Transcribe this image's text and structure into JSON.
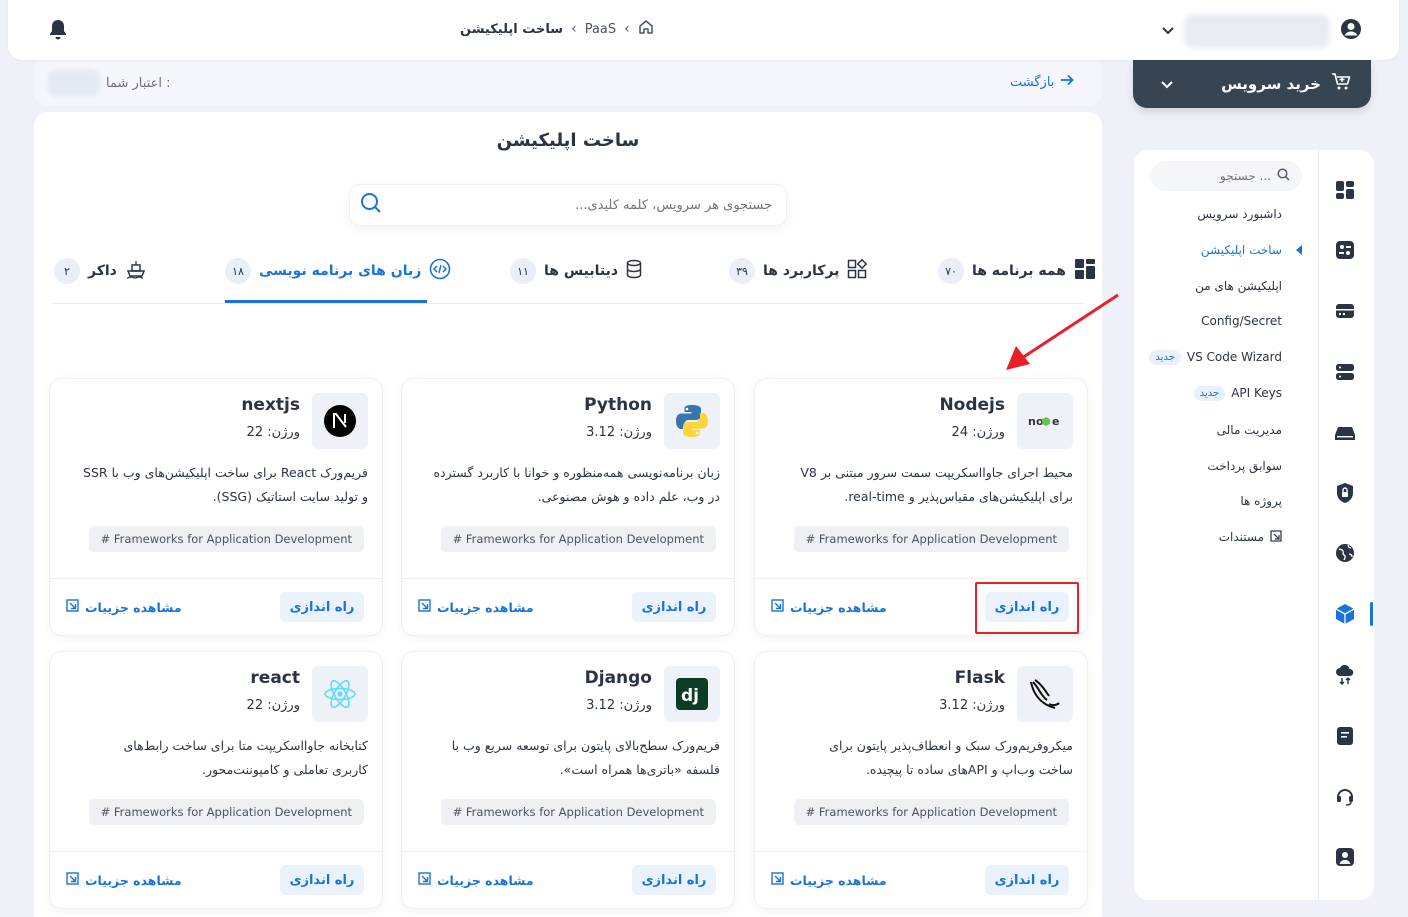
{
  "topbar": {
    "breadcrumb": {
      "current": "ساخت اپلیکیشن",
      "parent": "PaaS"
    }
  },
  "creditbar": {
    "back_label": "بازگشت",
    "credit_label": "اعتبار شما :"
  },
  "buy_button": {
    "label": "خرید سرویس"
  },
  "sidebar": {
    "search_placeholder": "جستجو ...",
    "items": [
      {
        "label": "داشبورد سرویس"
      },
      {
        "label": "ساخت اپلیکیشن"
      },
      {
        "label": "اپلیکیشن های من"
      },
      {
        "label": "Config/Secret"
      },
      {
        "label": "VS Code Wizard",
        "badge": "جدید"
      },
      {
        "label": "API Keys",
        "badge": "جدید"
      },
      {
        "label": "مدیریت مالی"
      },
      {
        "label": "سوابق پرداخت"
      },
      {
        "label": "پروژه ها"
      },
      {
        "label": "مستندات"
      }
    ],
    "rail_icons": [
      "dashboard-icon",
      "apps-icon",
      "server-icon",
      "storage-icon",
      "cloud-drive-icon",
      "security-icon",
      "globe-icon",
      "box-icon",
      "cloud-transfer-icon",
      "document-icon",
      "headset-icon",
      "account-icon"
    ]
  },
  "main": {
    "title": "ساخت اپلیکیشن",
    "search_placeholder": "جستجوی هر سرویس، کلمه کلیدی...",
    "tabs": [
      {
        "label": "همه برنامه ها",
        "count": "۷۰"
      },
      {
        "label": "پرکاربرد ها",
        "count": "۳۹"
      },
      {
        "label": "دیتابیس ها",
        "count": "۱۱"
      },
      {
        "label": "زبان های برنامه نویسی",
        "count": "۱۸"
      },
      {
        "label": "داکر",
        "count": "۲"
      }
    ],
    "cards": [
      {
        "name": "Nodejs",
        "version": "ورژن: 24",
        "desc1": "محیط اجرای جاوااسکریپت سمت سرور مبتنی بر V8",
        "desc2": "برای اپلیکیشن‌های مقیاس‌پذیر و real-time.",
        "tag": "# Frameworks for Application Development",
        "setup": "راه اندازی",
        "details": "مشاهده جزییات"
      },
      {
        "name": "Python",
        "version": "ورژن: 3.12",
        "desc1": "زبان برنامه‌نویسی همه‌منظوره و خوانا با کاربرد گسترده",
        "desc2": "در وب، علم داده و هوش مصنوعی.",
        "tag": "# Frameworks for Application Development",
        "setup": "راه اندازی",
        "details": "مشاهده جزییات"
      },
      {
        "name": "nextjs",
        "version": "ورژن: 22",
        "desc1": "فریم‌ورک React برای ساخت اپلیکیشن‌های وب با SSR",
        "desc2": "و تولید سایت استاتیک (SSG).",
        "tag": "# Frameworks for Application Development",
        "setup": "راه اندازی",
        "details": "مشاهده جزییات"
      },
      {
        "name": "Flask",
        "version": "ورژن: 3.12",
        "desc1": "میکروفریم‌ورک سبک و انعطاف‌پذیر پایتون برای",
        "desc2": "ساخت وب‌اپ و APIهای ساده تا پیچیده.",
        "tag": "# Frameworks for Application Development",
        "setup": "راه اندازی",
        "details": "مشاهده جزییات"
      },
      {
        "name": "Django",
        "version": "ورژن: 3.12",
        "desc1": "فریم‌ورک سطح‌بالای پایتون برای توسعه سریع وب با",
        "desc2": "فلسفه «باتری‌ها همراه است».",
        "tag": "# Frameworks for Application Development",
        "setup": "راه اندازی",
        "details": "مشاهده جزییات"
      },
      {
        "name": "react",
        "version": "ورژن: 22",
        "desc1": "کتابخانه جاوااسکریپت متا برای ساخت رابط‌های",
        "desc2": "کاربری تعاملی و کامپوننت‌محور.",
        "tag": "# Frameworks for Application Development",
        "setup": "راه اندازی",
        "details": "مشاهده جزییات"
      }
    ]
  },
  "colors": {
    "accent": "#1a73d9",
    "dark": "#374451",
    "highlight": "#e8202a"
  }
}
